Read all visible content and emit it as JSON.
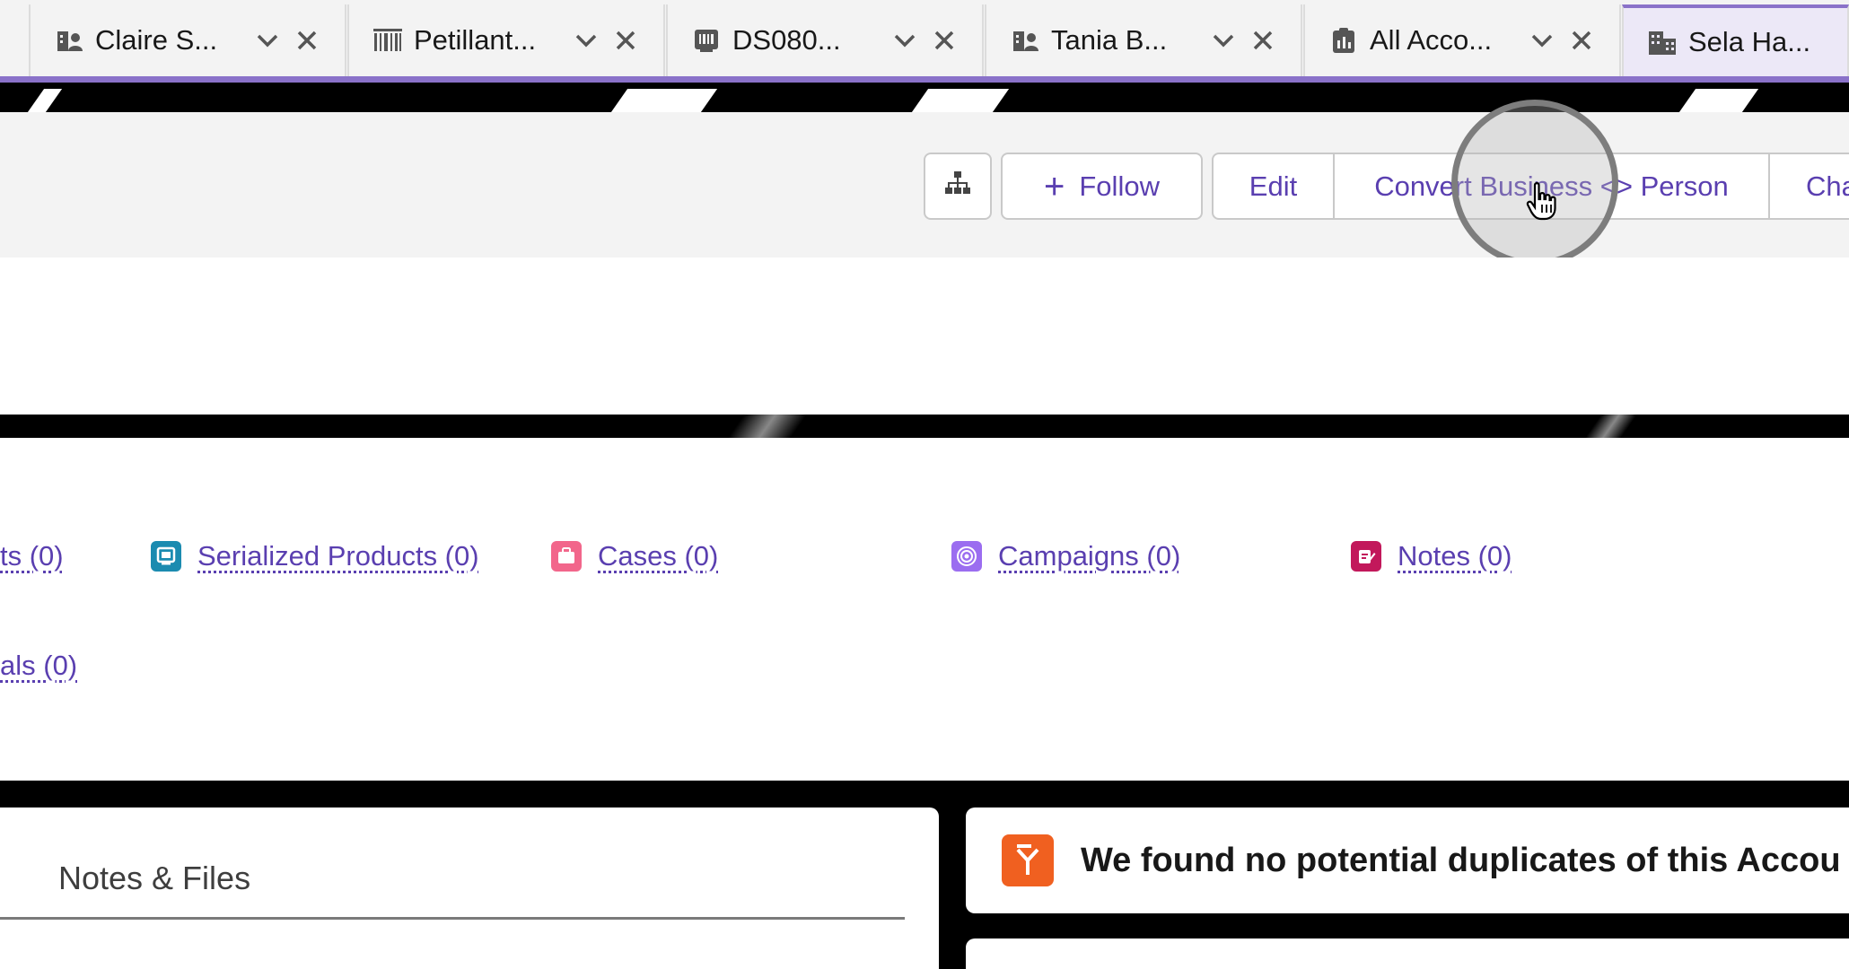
{
  "tabs": [
    {
      "label": "Claire S...",
      "icon": "person-account-icon"
    },
    {
      "label": "Petillant...",
      "icon": "barcode-icon"
    },
    {
      "label": "DS080...",
      "icon": "serialized-product-icon"
    },
    {
      "label": "Tania B...",
      "icon": "person-account-icon"
    },
    {
      "label": "All Acco...",
      "icon": "clipboard-icon"
    },
    {
      "label": "Sela Ha...",
      "icon": "building-icon"
    }
  ],
  "header": {
    "follow_label": "Follow",
    "edit_label": "Edit",
    "convert_label": "Convert Business <> Person",
    "change_label": "Cha"
  },
  "related": {
    "partial_top": "ts (0)",
    "serialized_products": "Serialized Products (0)",
    "cases": "Cases (0)",
    "campaigns": "Campaigns (0)",
    "notes": "Notes (0)",
    "partial_bottom": "als (0)"
  },
  "cards": {
    "notes_files_title": "Notes & Files",
    "duplicates_message": "We found no potential duplicates of this Accou"
  },
  "colors": {
    "accent": "#8a72c9",
    "link": "#5a3fb0",
    "serialized_icon_bg": "#1b8bb0",
    "cases_icon_bg": "#f2668b",
    "campaigns_icon_bg": "#9b6df0",
    "notes_icon_bg": "#c2185b",
    "duplicate_icon_bg": "#f06020"
  }
}
